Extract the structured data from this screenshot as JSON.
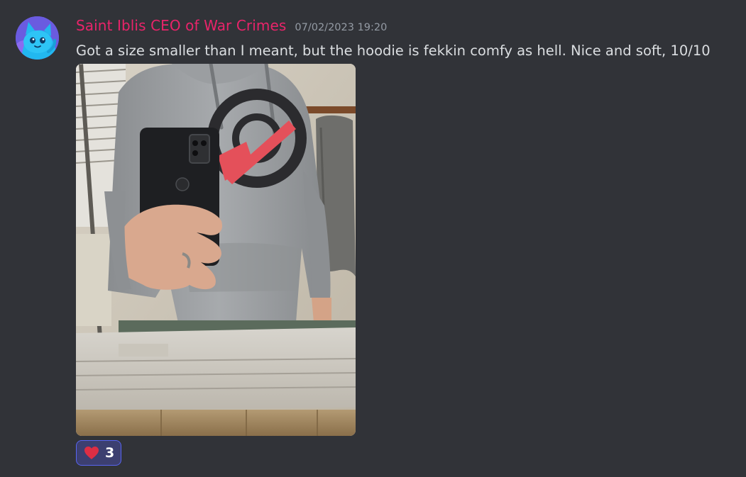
{
  "message": {
    "author": "Saint Iblis CEO of War Crimes",
    "timestamp": "07/02/2023 19:20",
    "content": "Got a size smaller than I meant, but the hoodie is fekkin comfy as hell. Nice and soft, 10/10",
    "author_color": "#e9246a"
  },
  "avatar": {
    "icon": "blue-cat-avatar-icon",
    "bg_color": "#6a5be0"
  },
  "attachment": {
    "type": "image",
    "depicts": "mirror-selfie-hoodie-photo"
  },
  "reactions": [
    {
      "emoji": "heart-icon",
      "count": "3",
      "color": "#dd2e44"
    }
  ],
  "colors": {
    "background": "#313338",
    "text": "#dbdee1",
    "timestamp": "#949ba4",
    "reaction_bg": "#3c3f70",
    "reaction_border": "#5865f2"
  }
}
